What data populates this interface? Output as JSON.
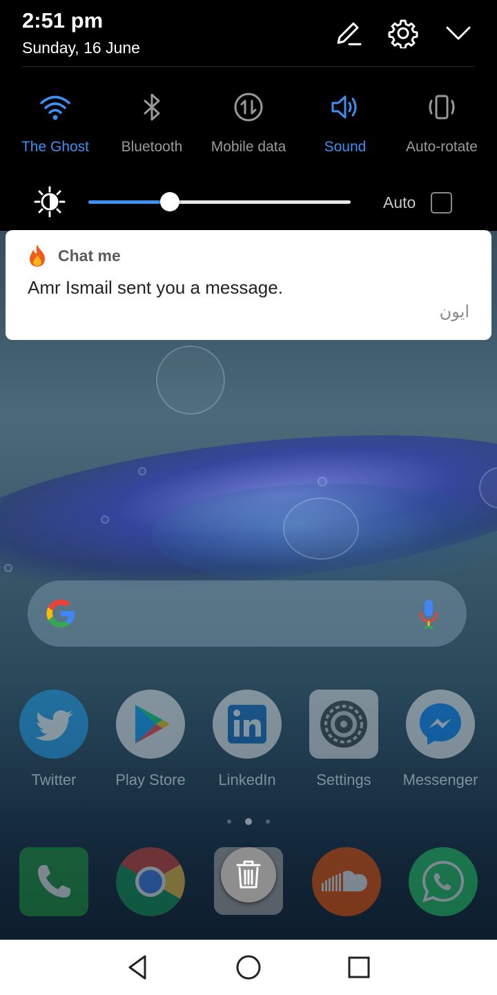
{
  "status": {
    "time": "2:51 pm",
    "date": "Sunday, 16 June"
  },
  "header_icons": [
    "edit-icon",
    "settings-icon",
    "collapse-icon"
  ],
  "quick_tiles": [
    {
      "label": "The Ghost",
      "icon": "wifi-icon",
      "active": true
    },
    {
      "label": "Bluetooth",
      "icon": "bluetooth-icon",
      "active": false
    },
    {
      "label": "Mobile data",
      "icon": "mobile-data-icon",
      "active": false
    },
    {
      "label": "Sound",
      "icon": "sound-icon",
      "active": true
    },
    {
      "label": "Auto-rotate",
      "icon": "auto-rotate-icon",
      "active": false
    }
  ],
  "brightness": {
    "level": 0.31,
    "auto_label": "Auto",
    "auto_checked": false
  },
  "notification": {
    "app_name": "Chat me",
    "app_icon": "flame-icon",
    "message": "Amr Ismail sent you a message.",
    "sub_text": "ايون"
  },
  "search_bar": {
    "icons": [
      "google-icon",
      "mic-icon"
    ]
  },
  "apps": [
    {
      "label": "Twitter",
      "icon": "twitter-icon"
    },
    {
      "label": "Play Store",
      "icon": "play-store-icon"
    },
    {
      "label": "LinkedIn",
      "icon": "linkedin-icon"
    },
    {
      "label": "Settings",
      "icon": "settings-app-icon"
    },
    {
      "label": "Messenger",
      "icon": "messenger-icon"
    }
  ],
  "dock": [
    {
      "icon": "phone-icon"
    },
    {
      "icon": "chrome-icon"
    },
    {
      "icon": "trash-icon"
    },
    {
      "icon": "soundcloud-icon"
    },
    {
      "icon": "whatsapp-icon"
    }
  ],
  "page_indicator": {
    "count": 3,
    "current": 1
  },
  "colors": {
    "accent": "#3a92f5",
    "shade_bg": "#000000",
    "card_bg": "#ffffff"
  }
}
